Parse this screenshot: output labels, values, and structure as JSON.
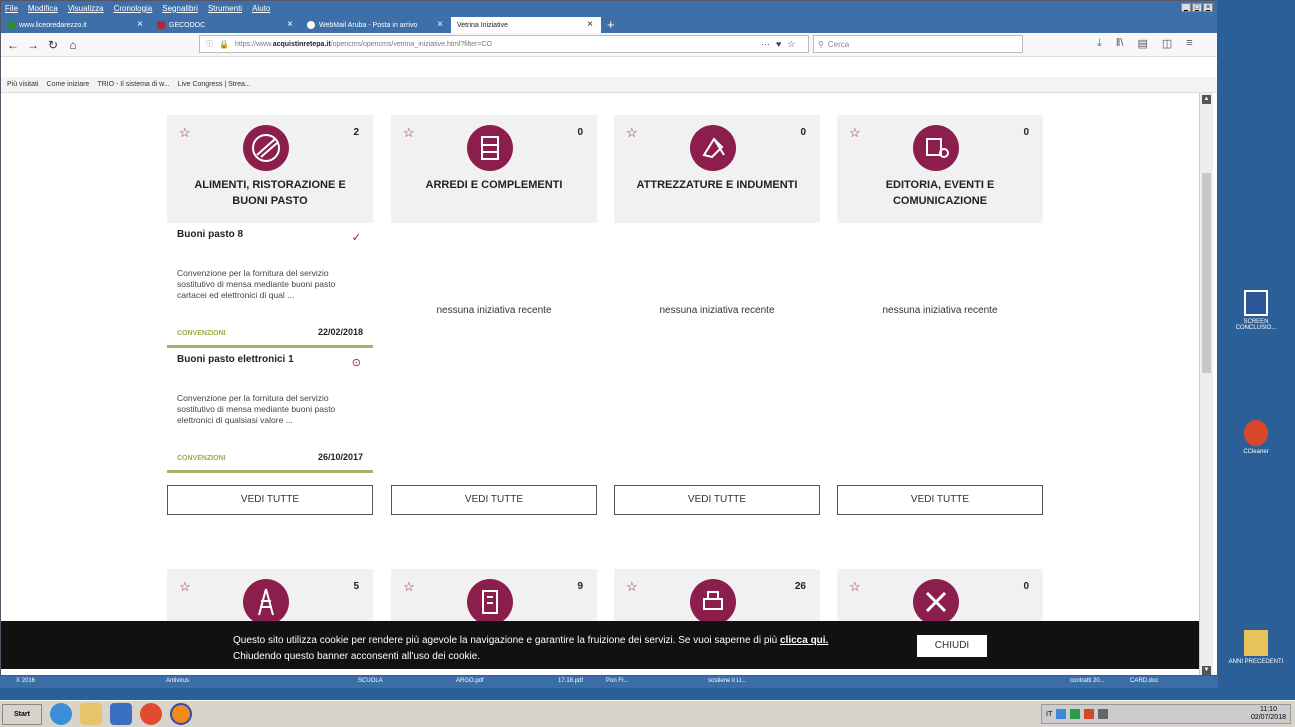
{
  "menubar": [
    "File",
    "Modifica",
    "Visualizza",
    "Cronologia",
    "Segnalibri",
    "Strumenti",
    "Aiuto"
  ],
  "tabs": [
    {
      "label": "www.liceoredarezzo.it"
    },
    {
      "label": "GECODOC"
    },
    {
      "label": "WebMail Aruba - Posta in arrivo"
    },
    {
      "label": "Vetrina Iniziative"
    }
  ],
  "url": {
    "prefix": "https://www.",
    "domain": "acquistinretepa.it",
    "path": "/opencms/opencms/vetrina_iniziative.html?filter=CO"
  },
  "search_placeholder": "Cerca",
  "bookmarks": [
    "Più visitati",
    "Come iniziare",
    "TRIO - Il sistema di w...",
    "Live Congress | Strea..."
  ],
  "cards": [
    {
      "category": "ALIMENTI, RISTORAZIONE E BUONI PASTO",
      "count": "2",
      "items": [
        {
          "title": "Buoni pasto 8",
          "desc": "Convenzione per la fornitura del servizio sostitutivo di mensa mediante buoni pasto cartacei ed elettronici di qual ...",
          "kind": "CONVENZIONI",
          "date": "22/02/2018",
          "status": "✓"
        },
        {
          "title": "Buoni pasto elettronici 1",
          "desc": "Convenzione per la fornitura del servizio sostitutivo di mensa mediante buoni pasto elettronici di qualsiasi valore ...",
          "kind": "CONVENZIONI",
          "date": "26/10/2017",
          "status": "⊙"
        }
      ]
    },
    {
      "category": "ARREDI E COMPLEMENTI",
      "count": "0",
      "empty": "nessuna iniziativa recente"
    },
    {
      "category": "ATTREZZATURE E INDUMENTI",
      "count": "0",
      "empty": "nessuna iniziativa recente"
    },
    {
      "category": "EDITORIA, EVENTI E COMUNICAZIONE",
      "count": "0",
      "empty": "nessuna iniziativa recente"
    }
  ],
  "see_all": "VEDI TUTTE",
  "cards2": [
    {
      "count": "5"
    },
    {
      "count": "9"
    },
    {
      "count": "26"
    },
    {
      "count": "0"
    }
  ],
  "cookie": {
    "text": "Questo sito utilizza cookie per rendere più agevole la navigazione e garantire la fruizione dei servizi. Se vuoi saperne di più ",
    "link": "clicca qui.",
    "text2": "Chiudendo questo banner acconsenti all'uso dei cookie.",
    "close": "CHIUDI"
  },
  "desktop": [
    {
      "label": "SCREEN CONCLUSIO..."
    },
    {
      "label": "CCleaner"
    },
    {
      "label": "ANNI PRECEDENTI"
    }
  ],
  "taskbar": {
    "start": "Start",
    "time": "11:10",
    "date": "02/07/2018",
    "lang": "IT"
  },
  "oldbar": [
    "X 2016",
    "Antivirus",
    "SCUOLA",
    "ARGO.pdf",
    "17.18.pdf",
    "Pon FI...",
    "sostiene il LI...",
    "contratti 20...",
    "CARD.doc"
  ],
  "colors": {
    "accent": "#8c1e4d",
    "green": "#9aad4e"
  }
}
